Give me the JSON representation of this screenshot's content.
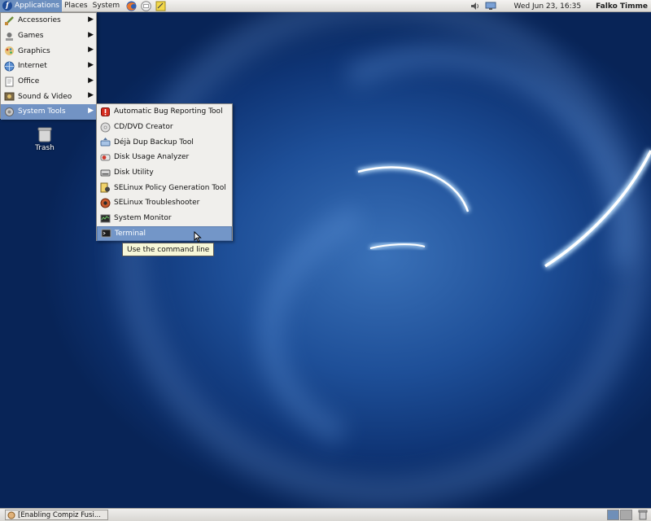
{
  "top_panel": {
    "menus": [
      "Applications",
      "Places",
      "System"
    ],
    "clock": "Wed Jun 23, 16:35",
    "user": "Falko Timme"
  },
  "desktop": {
    "trash_label": "Trash"
  },
  "applications_menu": {
    "items": [
      {
        "label": "Accessories",
        "icon": "accessories-icon"
      },
      {
        "label": "Games",
        "icon": "games-icon"
      },
      {
        "label": "Graphics",
        "icon": "graphics-icon"
      },
      {
        "label": "Internet",
        "icon": "internet-icon"
      },
      {
        "label": "Office",
        "icon": "office-icon"
      },
      {
        "label": "Sound & Video",
        "icon": "sound-video-icon"
      },
      {
        "label": "System Tools",
        "icon": "system-tools-icon",
        "selected": true
      }
    ]
  },
  "system_tools_menu": {
    "items": [
      {
        "label": "Automatic Bug Reporting Tool",
        "icon": "bug-report-icon"
      },
      {
        "label": "CD/DVD Creator",
        "icon": "cd-dvd-icon"
      },
      {
        "label": "Déjà Dup Backup Tool",
        "icon": "backup-icon"
      },
      {
        "label": "Disk Usage Analyzer",
        "icon": "disk-usage-icon"
      },
      {
        "label": "Disk Utility",
        "icon": "disk-utility-icon"
      },
      {
        "label": "SELinux Policy Generation Tool",
        "icon": "selinux-policy-icon"
      },
      {
        "label": "SELinux Troubleshooter",
        "icon": "selinux-troubleshooter-icon"
      },
      {
        "label": "System Monitor",
        "icon": "system-monitor-icon"
      },
      {
        "label": "Terminal",
        "icon": "terminal-icon",
        "selected": true
      }
    ]
  },
  "tooltip": "Use the command line",
  "bottom_panel": {
    "task_label": "[Enabling Compiz Fusi..."
  },
  "colors": {
    "selection": "#7293c4",
    "wallpaper_dark": "#082457",
    "wallpaper_light": "#3a71b8"
  }
}
